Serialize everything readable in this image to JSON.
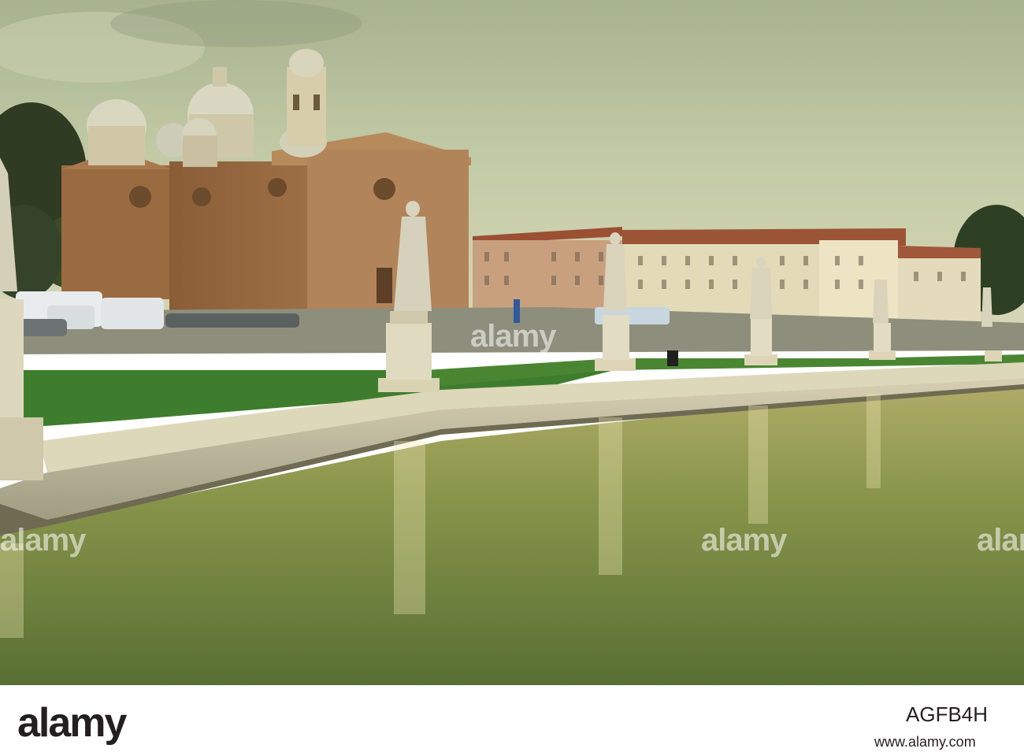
{
  "watermark": {
    "text": "alamy"
  },
  "footer": {
    "brand": "alamy",
    "image_ref": "AGFB4H",
    "url": "www.alamy.com"
  },
  "colors": {
    "sky": "#b9c4a4",
    "water": "#7f8f4a",
    "grass": "#3f7b2a",
    "brick": "#9a6a3d"
  }
}
